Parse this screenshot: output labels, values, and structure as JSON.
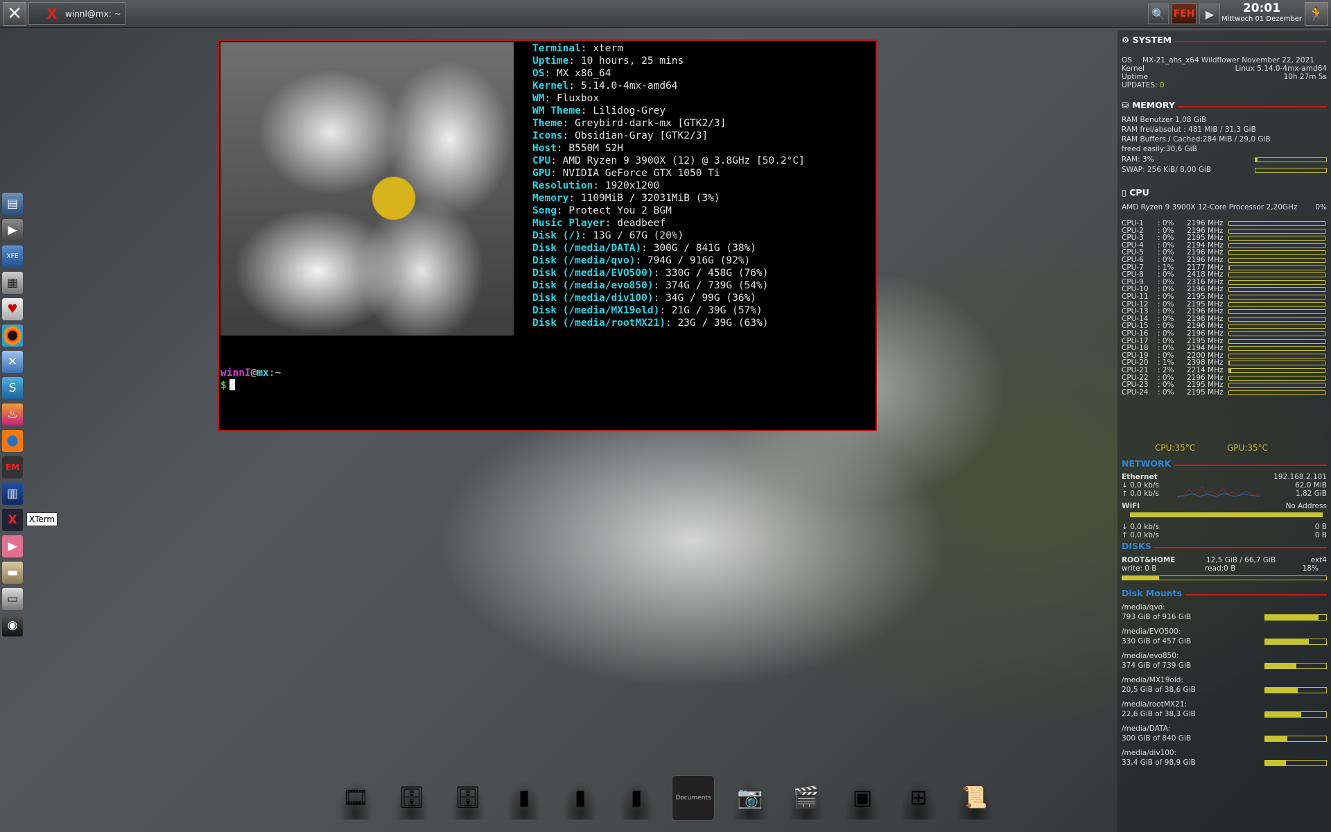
{
  "taskbar": {
    "task_title": "winnI@mx: ~",
    "feh_label": "FEH",
    "clock_time": "20:01",
    "clock_date": "Mittwoch 01 Dezember"
  },
  "launcher": {
    "items": [
      "file-manager-icon",
      "media-player-icon",
      "xfe-icon",
      "calculator-icon",
      "solitaire-icon",
      "aperture-icon",
      "xterm-blue-icon",
      "swirl-icon",
      "flame-icon",
      "firefox-icon",
      "em-icon",
      "news-icon",
      "xterm-icon",
      "youtube-icon",
      "book-icon",
      "scanner-icon",
      "camera-icon"
    ],
    "em_label": "EM",
    "tooltip": "XTerm"
  },
  "terminal": {
    "info": [
      {
        "k": "Terminal",
        "v": "xterm"
      },
      {
        "k": "Uptime",
        "v": "10 hours, 25 mins"
      },
      {
        "k": "OS",
        "v": "MX x86_64"
      },
      {
        "k": "Kernel",
        "v": "5.14.0-4mx-amd64"
      },
      {
        "k": "WM",
        "v": "Fluxbox"
      },
      {
        "k": "WM Theme",
        "v": "Lilidog-Grey"
      },
      {
        "k": "Theme",
        "v": "Greybird-dark-mx [GTK2/3]"
      },
      {
        "k": "Icons",
        "v": "Obsidian-Gray [GTK2/3]"
      },
      {
        "k": "Host",
        "v": "B550M S2H"
      },
      {
        "k": "CPU",
        "v": "AMD Ryzen 9 3900X (12) @ 3.8GHz [50.2°C]"
      },
      {
        "k": "GPU",
        "v": "NVIDIA GeForce GTX 1050 Ti"
      },
      {
        "k": "Resolution",
        "v": "1920x1200"
      },
      {
        "k": "Memory",
        "v": "1109MiB / 32031MiB (3%)"
      },
      {
        "k": "Song",
        "v": "Protect You 2 BGM"
      },
      {
        "k": "Music Player",
        "v": "deadbeef"
      },
      {
        "k": "Disk (/)",
        "v": "13G / 67G (20%)"
      },
      {
        "k": "Disk (/media/DATA)",
        "v": "300G / 841G (38%)"
      },
      {
        "k": "Disk (/media/qvo)",
        "v": "794G / 916G (92%)"
      },
      {
        "k": "Disk (/media/EVO500)",
        "v": "330G / 458G (76%)"
      },
      {
        "k": "Disk (/media/evo850)",
        "v": "374G / 739G (54%)"
      },
      {
        "k": "Disk (/media/div100)",
        "v": "34G / 99G (36%)"
      },
      {
        "k": "Disk (/media/MX19old)",
        "v": "21G / 39G (57%)"
      },
      {
        "k": "Disk (/media/rootMX21)",
        "v": "23G / 39G (63%)"
      }
    ],
    "prompt_user": "winnI",
    "prompt_at": "@",
    "prompt_host": "mx",
    "prompt_path": ":~",
    "prompt_dollar": "$"
  },
  "conky": {
    "system_title": "SYSTEM",
    "os_label": "OS",
    "os_value": "MX-21_ahs_x64 Wildflower November 22, 2021",
    "kernel_label": "Kernel",
    "kernel_value": "Linux 5.14.0-4mx-amd64",
    "uptime_label": "Uptime",
    "uptime_value": "10h 27m 5s",
    "updates_label": "UPDATES:",
    "updates_value": "0",
    "memory_title": "MEMORY",
    "ram_user": "RAM Benutzer 1,08 GiB",
    "ram_free": "RAM frei/absolut : 481 MiB / 31,3 GiB",
    "ram_buffers": "RAM Buffers / Cached:284 MiB / 29,0 GiB",
    "freed": "freed easily:30,6 GiB",
    "ram_pct": "RAM: 3%",
    "ram_fill": 0.03,
    "swap": "SWAP: 256 KiB/ 8,00 GiB",
    "swap_fill": 0.0,
    "cpu_title": "CPU",
    "cpu_model": "AMD Ryzen 9 3900X 12-Core Processor 2,20GHz",
    "cpu_total": "0%",
    "cpus": [
      {
        "n": "CPU-1",
        "p": ": 0%",
        "m": "2196 MHz"
      },
      {
        "n": "CPU-2",
        "p": ": 0%",
        "m": "2196 MHz"
      },
      {
        "n": "CPU-3",
        "p": ": 0%",
        "m": "2195 MHz"
      },
      {
        "n": "CPU-4",
        "p": ": 0%",
        "m": "2194 MHz"
      },
      {
        "n": "CPU-5",
        "p": ": 0%",
        "m": "2196 MHz"
      },
      {
        "n": "CPU-6",
        "p": ": 0%",
        "m": "2196 MHz"
      },
      {
        "n": "CPU-7",
        "p": ": 1%",
        "m": "2177 MHz"
      },
      {
        "n": "CPU-8",
        "p": ": 0%",
        "m": "2418 MHz"
      },
      {
        "n": "CPU-9",
        "p": ": 0%",
        "m": "2316 MHz"
      },
      {
        "n": "CPU-10",
        "p": ": 0%",
        "m": "2196 MHz"
      },
      {
        "n": "CPU-11",
        "p": ": 0%",
        "m": "2195 MHz"
      },
      {
        "n": "CPU-12",
        "p": ": 0%",
        "m": "2195 MHz"
      },
      {
        "n": "CPU-13",
        "p": ": 0%",
        "m": "2196 MHz"
      },
      {
        "n": "CPU-14",
        "p": ": 0%",
        "m": "2196 MHz"
      },
      {
        "n": "CPU-15",
        "p": ": 0%",
        "m": "2196 MHz"
      },
      {
        "n": "CPU-16",
        "p": ": 0%",
        "m": "2196 MHz"
      },
      {
        "n": "CPU-17",
        "p": ": 0%",
        "m": "2195 MHz"
      },
      {
        "n": "CPU-18",
        "p": ": 0%",
        "m": "2194 MHz"
      },
      {
        "n": "CPU-19",
        "p": ": 0%",
        "m": "2200 MHz"
      },
      {
        "n": "CPU-20",
        "p": ": 1%",
        "m": "2398 MHz"
      },
      {
        "n": "CPU-21",
        "p": ": 2%",
        "m": "2214 MHz"
      },
      {
        "n": "CPU-22",
        "p": ": 0%",
        "m": "2196 MHz"
      },
      {
        "n": "CPU-23",
        "p": ": 0%",
        "m": "2195 MHz"
      },
      {
        "n": "CPU-24",
        "p": ": 0%",
        "m": "2195 MHz"
      }
    ],
    "cpu_temp": "CPU:35°C",
    "gpu_temp": "GPU:35°C",
    "network_title": "NETWORK",
    "eth_label": "Ethernet",
    "eth_ip": "192.168.2.101",
    "eth_down": "0,0 kb/s",
    "eth_down_total": "62,0 MiB",
    "eth_up": "0,0 kb/s",
    "eth_up_total": "1,82 GiB",
    "wifi_label": "WiFi",
    "wifi_addr": "No Address",
    "wifi_down": "0,0 kb/s",
    "wifi_down_total": "0 B",
    "wifi_up": "0,0 kb/s",
    "wifi_up_total": "0 B",
    "disks_title": "DISKS",
    "root_label": "ROOT&HOME",
    "root_size": "12,5 GiB / 66,7 GiB",
    "root_fs": "ext4",
    "root_write": "write: 0 B",
    "root_read": "read:0 B",
    "root_pct": "18%",
    "root_fill": 0.18,
    "mounts_title": "Disk Mounts",
    "mounts": [
      {
        "path": "/media/qvo:",
        "size": "793 GiB of 916 GiB",
        "fill": 0.87
      },
      {
        "path": "/media/EVO500:",
        "size": "330 GiB of 457 GiB",
        "fill": 0.72
      },
      {
        "path": "/media/evo850:",
        "size": "374 GiB of 739 GiB",
        "fill": 0.51
      },
      {
        "path": "/media/MX19old:",
        "size": "20,5 GiB of 38,6 GiB",
        "fill": 0.53
      },
      {
        "path": "/media/rootMX21:",
        "size": "22,6 GiB of 38,3 GiB",
        "fill": 0.59
      },
      {
        "path": "/media/DATA:",
        "size": "300 GiB of 840 GiB",
        "fill": 0.36
      },
      {
        "path": "/media/div100:",
        "size": "33,4 GiB of 98,9 GiB",
        "fill": 0.34
      }
    ]
  },
  "dock": {
    "items": [
      "film-reel-icon",
      "drive-icon",
      "drive-2-icon",
      "usb-drive-icon",
      "black-drive-icon",
      "external-drive-icon",
      "documents-folder-icon",
      "webcam-icon",
      "media-player-icon",
      "safe-icon",
      "windows-icon",
      "papers-icon"
    ],
    "documents_label": "Documents"
  }
}
